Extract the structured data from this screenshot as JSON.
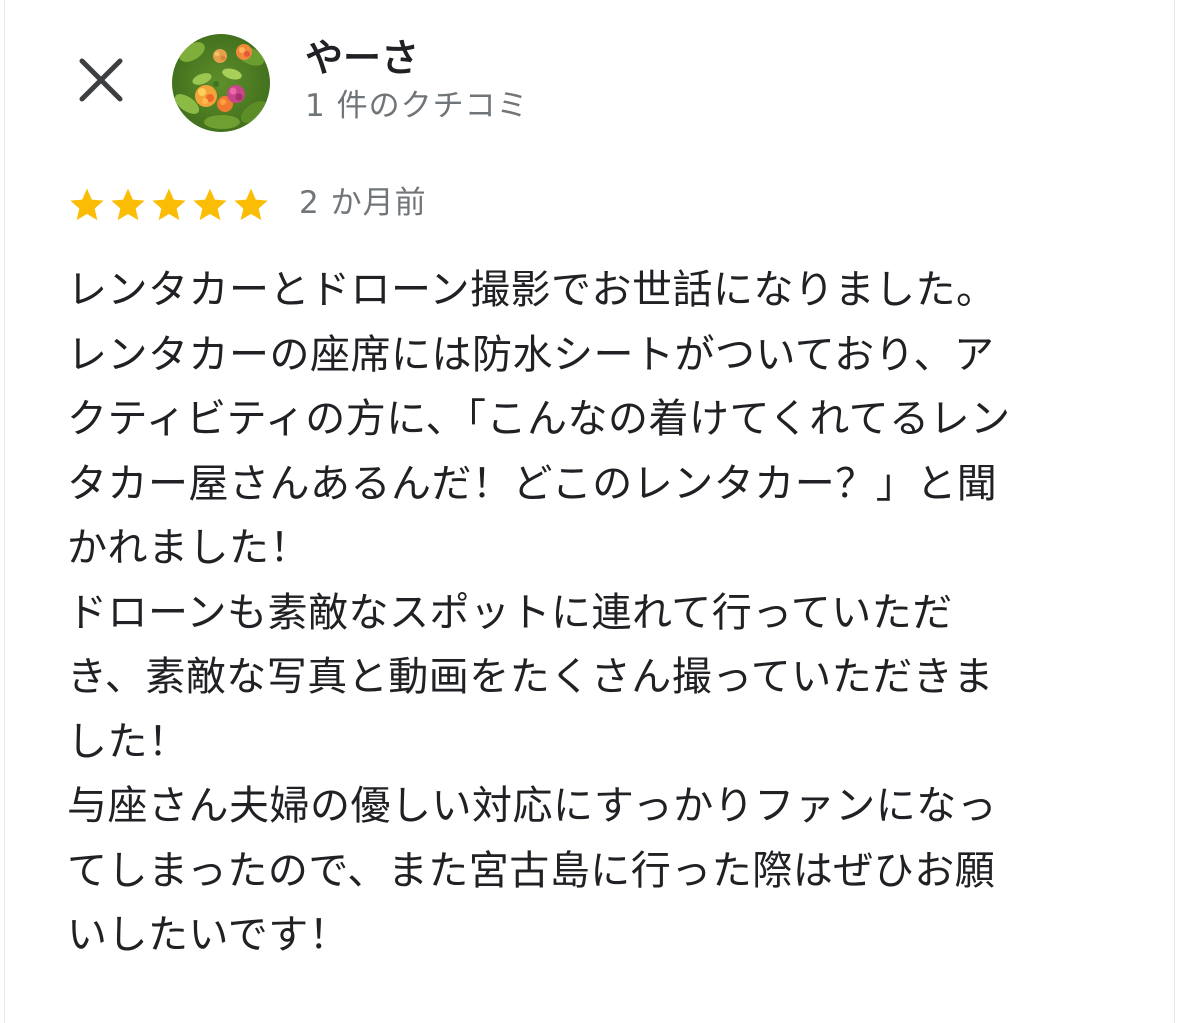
{
  "reviewer": {
    "name": "やーさ",
    "review_count": "1 件のクチコミ"
  },
  "review": {
    "rating": 5,
    "date": "2 か月前",
    "lines": [
      "レンタカーとドローン撮影でお世話になりました。",
      "レンタカーの座席には防水シートがついており、ア",
      "クティビティの方に、「こんなの着けてくれてるレン",
      "タカー屋さんあるんだ！どこのレンタカー？」と聞",
      "かれました！",
      "ドローンも素敵なスポットに連れて行っていただ",
      "き、素敵な写真と動画をたくさん撮っていただきま",
      "した！",
      "与座さん夫婦の優しい対応にすっかりファンになっ",
      "てしまったので、また宮古島に行った際はぜひお願",
      "いしたいです！"
    ]
  },
  "colors": {
    "star": "#fbbc04",
    "secondary_text": "#70757a",
    "primary_text": "#202124",
    "close_icon": "#3c4043"
  },
  "icons": {
    "close": "close-icon",
    "avatar": "flower-avatar",
    "star": "star-icon"
  }
}
